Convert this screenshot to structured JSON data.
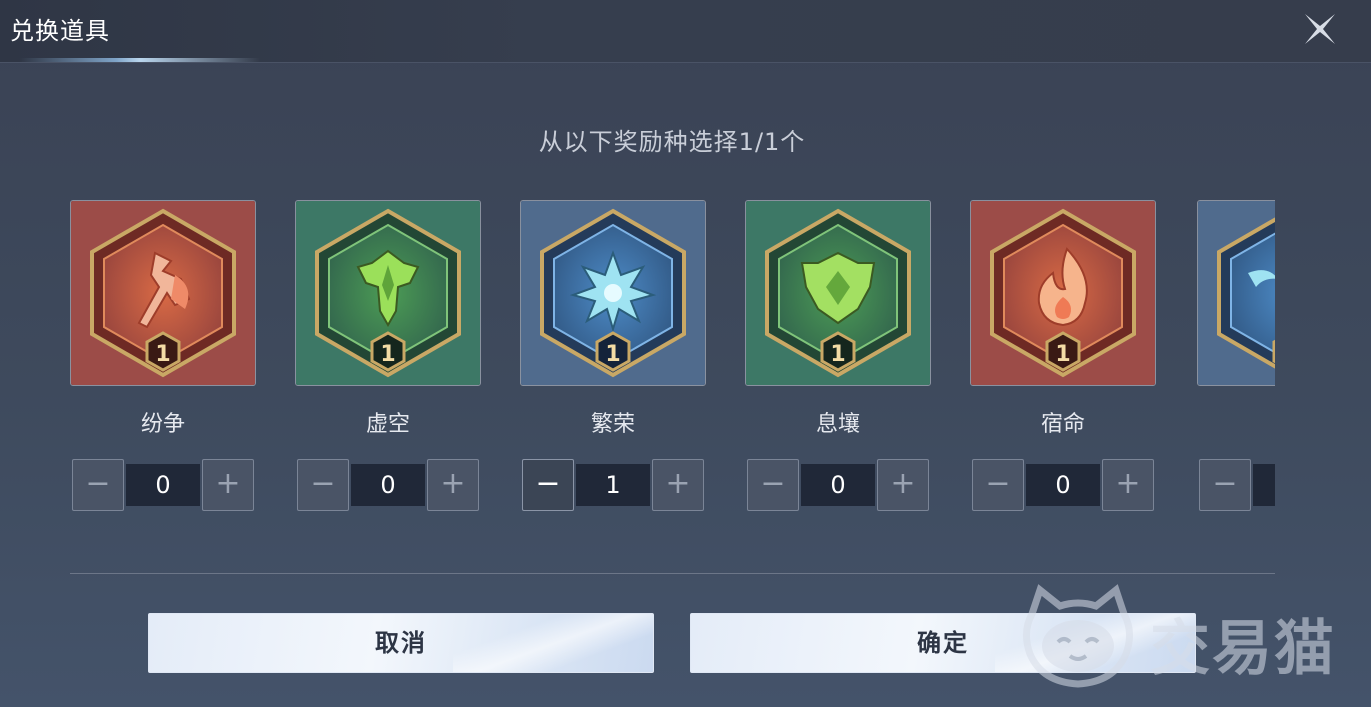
{
  "header": {
    "title": "兑换道具"
  },
  "subtitle": "从以下奖励种选择1/1个",
  "items": [
    {
      "name": "纷争",
      "badge": "1",
      "count": "0",
      "icon": "axe-icon",
      "theme": "red"
    },
    {
      "name": "虚空",
      "badge": "1",
      "count": "0",
      "icon": "void-crest-icon",
      "theme": "green"
    },
    {
      "name": "繁荣",
      "badge": "1",
      "count": "1",
      "icon": "star-snowflake-icon",
      "theme": "blue"
    },
    {
      "name": "息壤",
      "badge": "1",
      "count": "0",
      "icon": "leaf-shield-icon",
      "theme": "green"
    },
    {
      "name": "宿命",
      "badge": "1",
      "count": "0",
      "icon": "flame-icon",
      "theme": "red"
    },
    {
      "name": "",
      "badge": "",
      "count": "",
      "icon": "partial-blue-icon",
      "theme": "blue"
    }
  ],
  "stepper": {
    "minus_glyph": "−",
    "plus_glyph": "+"
  },
  "buttons": {
    "cancel": "取消",
    "confirm": "确定"
  },
  "watermark": {
    "text": "交易猫"
  },
  "colors": {
    "red_bg": "#a04a45",
    "green_bg": "#3e7a68",
    "blue_bg": "#4f6a8c",
    "gold": "#c9a865",
    "accent_text": "#ffffff"
  }
}
